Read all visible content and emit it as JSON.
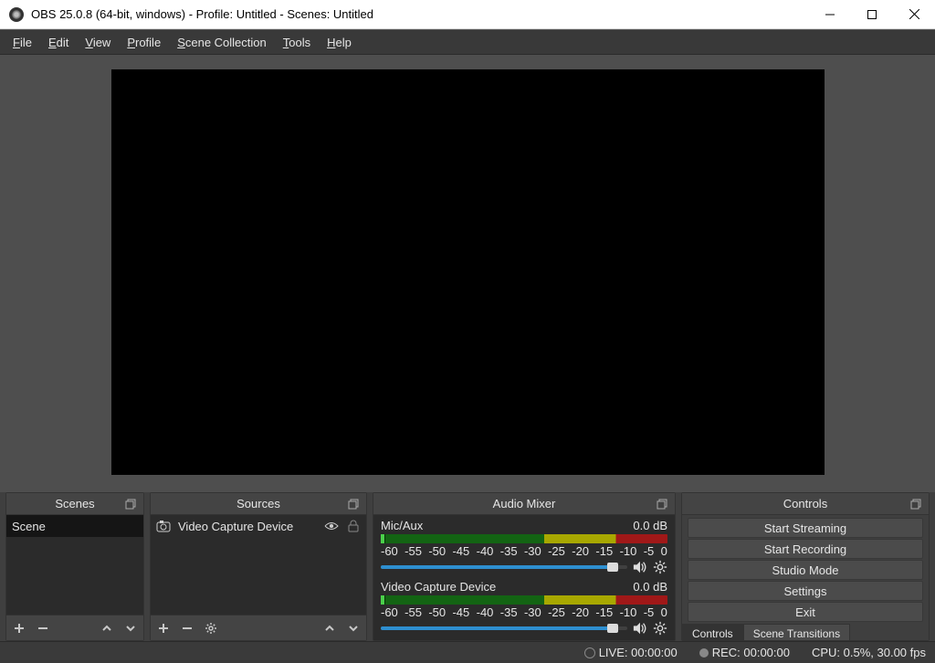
{
  "window": {
    "title": "OBS 25.0.8 (64-bit, windows) - Profile: Untitled - Scenes: Untitled"
  },
  "menus": [
    "File",
    "Edit",
    "View",
    "Profile",
    "Scene Collection",
    "Tools",
    "Help"
  ],
  "panels": {
    "scenes": {
      "title": "Scenes",
      "items": [
        "Scene"
      ]
    },
    "sources": {
      "title": "Sources",
      "items": [
        {
          "label": "Video Capture Device"
        }
      ]
    },
    "mixer": {
      "title": "Audio Mixer",
      "ticks": [
        "-60",
        "-55",
        "-50",
        "-45",
        "-40",
        "-35",
        "-30",
        "-25",
        "-20",
        "-15",
        "-10",
        "-5",
        "0"
      ],
      "channels": [
        {
          "name": "Mic/Aux",
          "db": "0.0 dB"
        },
        {
          "name": "Video Capture Device",
          "db": "0.0 dB"
        }
      ]
    },
    "controls": {
      "title": "Controls",
      "buttons": [
        "Start Streaming",
        "Start Recording",
        "Studio Mode",
        "Settings",
        "Exit"
      ],
      "tabs": [
        "Controls",
        "Scene Transitions"
      ]
    }
  },
  "status": {
    "live": "LIVE: 00:00:00",
    "rec": "REC: 00:00:00",
    "cpu": "CPU: 0.5%, 30.00 fps"
  }
}
